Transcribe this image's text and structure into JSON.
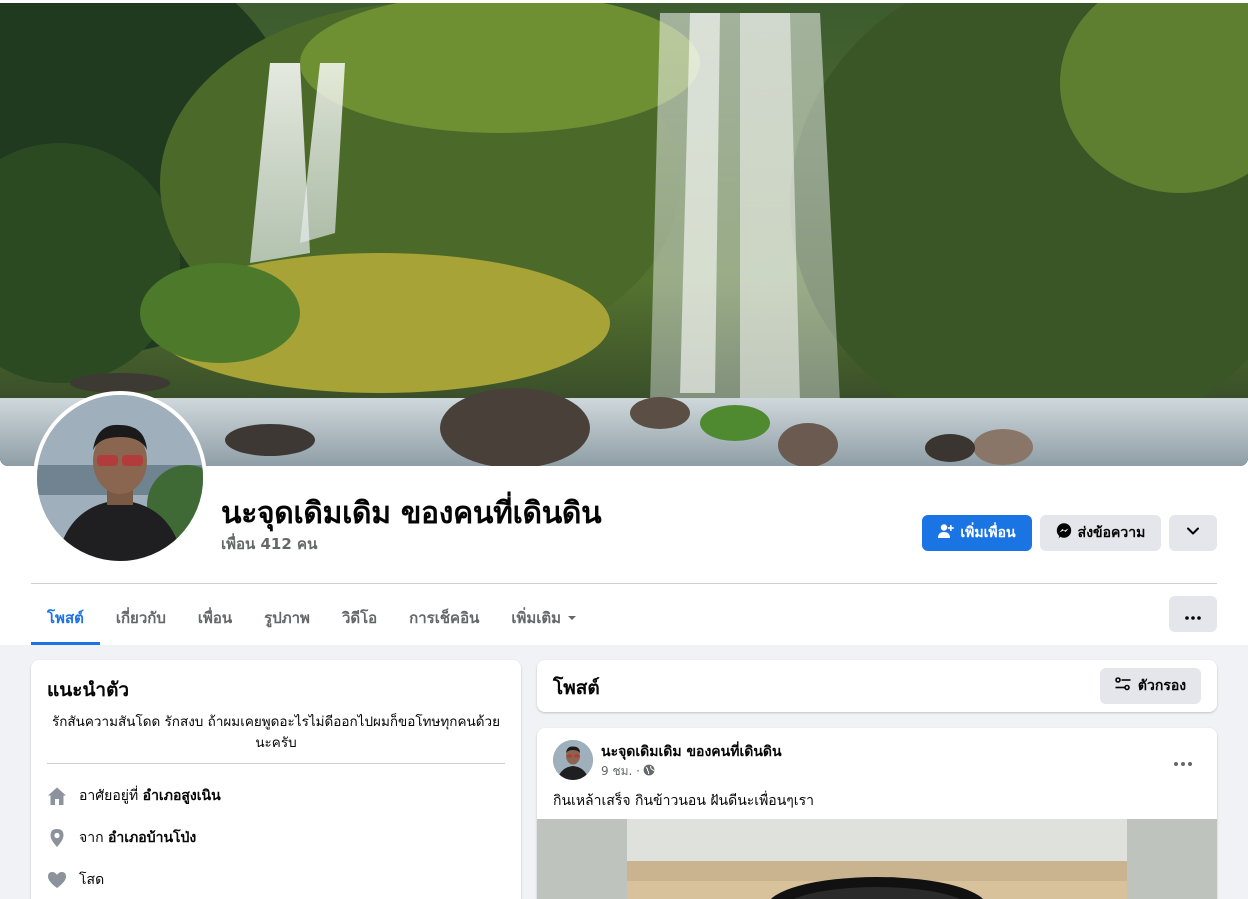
{
  "profile": {
    "name": "นะจุดเดิมเดิม ของคนที่เดินดิน",
    "friends_count": "เพื่อน 412 คน"
  },
  "actions": {
    "add_friend": "เพิ่มเพื่อน",
    "message": "ส่งข้อความ"
  },
  "tabs": [
    {
      "label": "โพสต์",
      "active": true
    },
    {
      "label": "เกี่ยวกับ"
    },
    {
      "label": "เพื่อน"
    },
    {
      "label": "รูปภาพ"
    },
    {
      "label": "วิดีโอ"
    },
    {
      "label": "การเช็คอิน"
    },
    {
      "label": "เพิ่มเติม"
    }
  ],
  "intro": {
    "title": "แนะนำตัว",
    "bio": "รักสันความสันโดด รักสงบ ถ้าผมเคยพูดอะไรไม่ดีออกไปผมก็ขอโทษทุกคนด้วยนะครับ",
    "lives_prefix": "อาศัยอยู่ที่",
    "lives_place": "อำเภอสูงเนิน",
    "from_prefix": "จาก",
    "from_place": "อำเภอบ้านโป่ง",
    "relationship": "โสด"
  },
  "posts_section": {
    "title": "โพสต์",
    "filter": "ตัวกรอง"
  },
  "post": {
    "author": "นะจุดเดิมเดิม ของคนที่เดินดิน",
    "time": "9 ชม. ·",
    "text": "กินเหล้าเสร็จ กินข้าวนอน ฝันดีนะเพื่อนๆเรา"
  },
  "colors": {
    "accent": "#1b74e4",
    "background": "#f0f2f5",
    "secondary_text": "#65676b"
  }
}
